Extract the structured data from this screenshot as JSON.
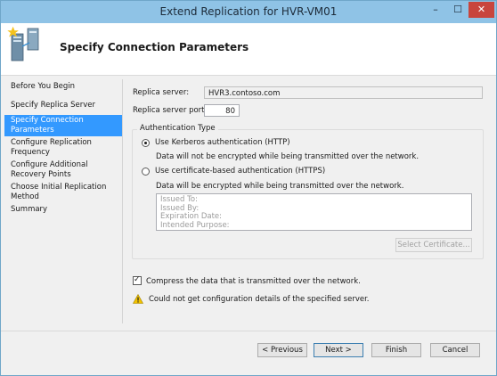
{
  "window": {
    "title": "Extend Replication for HVR-VM01",
    "controls": {
      "minimize": "–",
      "maximize": "☐",
      "close": "✕"
    }
  },
  "header": {
    "title": "Specify Connection Parameters",
    "icon": "replication-wizard-icon"
  },
  "nav": {
    "items": [
      {
        "label": "Before You Begin",
        "active": false
      },
      {
        "label": "Specify Replica Server",
        "active": false
      },
      {
        "label": "Specify Connection Parameters",
        "active": true
      },
      {
        "label": "Configure Replication Frequency",
        "active": false
      },
      {
        "label": "Configure Additional Recovery Points",
        "active": false
      },
      {
        "label": "Choose Initial Replication Method",
        "active": false
      },
      {
        "label": "Summary",
        "active": false
      }
    ]
  },
  "form": {
    "replica_server_label": "Replica server:",
    "replica_server_value": "HVR3.contoso.com",
    "port_label": "Replica server port:",
    "port_value": "80",
    "auth_group_title": "Authentication Type",
    "kerberos_label": "Use Kerberos authentication (HTTP)",
    "kerberos_selected": true,
    "kerberos_note": "Data will not be encrypted while being transmitted over the network.",
    "cert_label": "Use certificate-based authentication (HTTPS)",
    "cert_selected": false,
    "cert_note": "Data will be encrypted while being transmitted over the network.",
    "cert_fields": {
      "issued_to": "Issued To:",
      "issued_by": "Issued By:",
      "expiration": "Expiration Date:",
      "purpose": "Intended Purpose:"
    },
    "select_cert_button": "Select Certificate...",
    "compress_label": "Compress the data that is transmitted over the network.",
    "compress_checked": true,
    "warning_text": "Could not get configuration details of the specified server."
  },
  "buttons": {
    "previous": "< Previous",
    "next": "Next >",
    "finish": "Finish",
    "cancel": "Cancel"
  },
  "colors": {
    "titlebar": "#8fc3e6",
    "nav_active": "#3399ff",
    "close_button": "#c8453d",
    "warning": "#f2c200"
  }
}
